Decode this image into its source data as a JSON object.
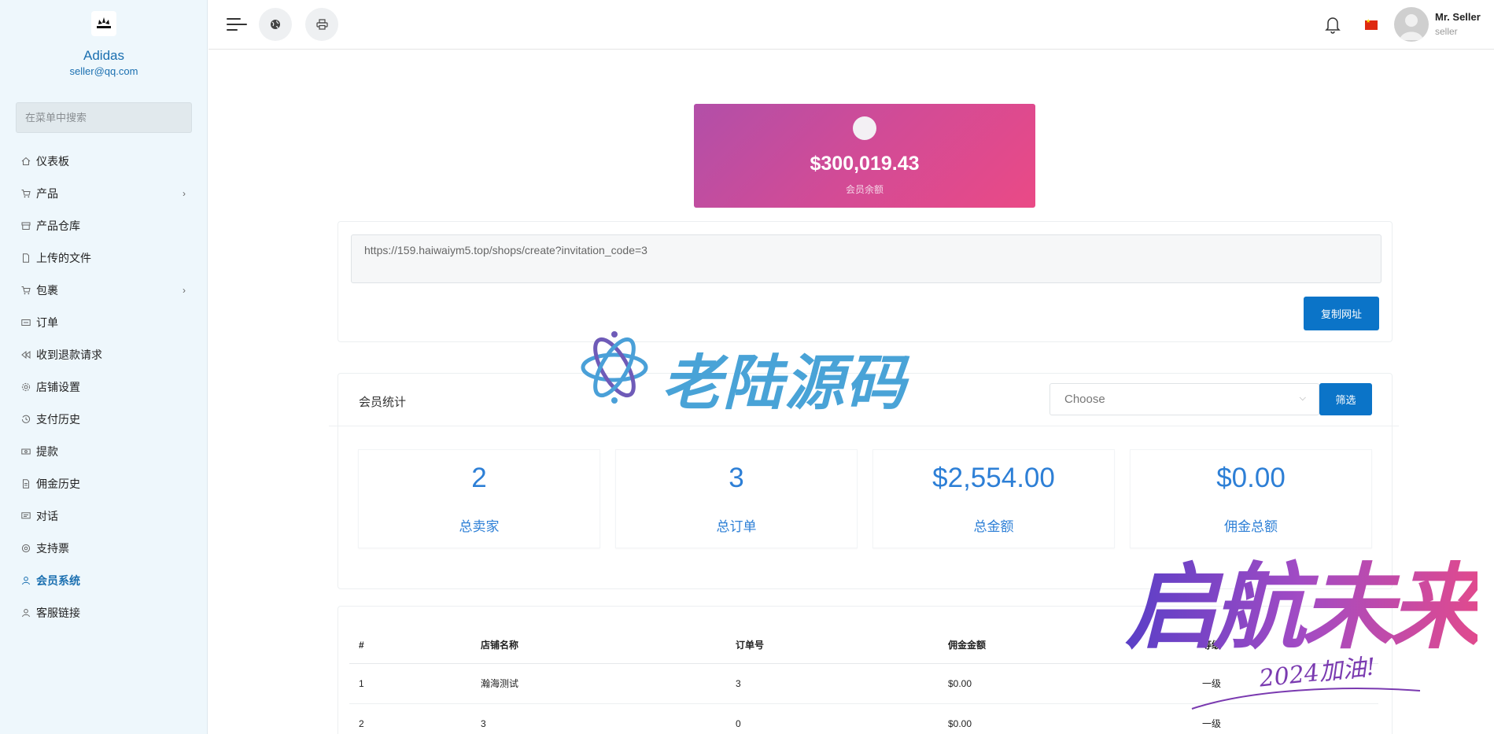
{
  "sidebar": {
    "brand_name": "Adidas",
    "brand_email": "seller@qq.com",
    "search_placeholder": "在菜单中搜索",
    "items": [
      {
        "label": "仪表板",
        "icon": "home-icon",
        "has_submenu": false,
        "active": false
      },
      {
        "label": "产品",
        "icon": "cart-icon",
        "has_submenu": true,
        "active": false
      },
      {
        "label": "产品仓库",
        "icon": "archive-icon",
        "has_submenu": false,
        "active": false
      },
      {
        "label": "上传的文件",
        "icon": "file-icon",
        "has_submenu": false,
        "active": false
      },
      {
        "label": "包裹",
        "icon": "cart-icon",
        "has_submenu": true,
        "active": false
      },
      {
        "label": "订单",
        "icon": "ticket-icon",
        "has_submenu": false,
        "active": false
      },
      {
        "label": "收到退款请求",
        "icon": "rewind-icon",
        "has_submenu": false,
        "active": false
      },
      {
        "label": "店铺设置",
        "icon": "gear-icon",
        "has_submenu": false,
        "active": false
      },
      {
        "label": "支付历史",
        "icon": "history-icon",
        "has_submenu": false,
        "active": false
      },
      {
        "label": "提款",
        "icon": "cash-icon",
        "has_submenu": false,
        "active": false
      },
      {
        "label": "佣金历史",
        "icon": "document-icon",
        "has_submenu": false,
        "active": false
      },
      {
        "label": "对话",
        "icon": "chat-icon",
        "has_submenu": false,
        "active": false
      },
      {
        "label": "支持票",
        "icon": "support-icon",
        "has_submenu": false,
        "active": false
      },
      {
        "label": "会员系统",
        "icon": "user-icon",
        "has_submenu": false,
        "active": true
      },
      {
        "label": "客服链接",
        "icon": "user-icon",
        "has_submenu": false,
        "active": false
      }
    ]
  },
  "topbar": {
    "user_name": "Mr. Seller",
    "user_role": "seller"
  },
  "balance": {
    "amount": "$300,019.43",
    "label": "会员余额"
  },
  "invite": {
    "url": "https://159.haiwaiym5.top/shops/create?invitation_code=3",
    "copy_label": "复制网址"
  },
  "stats": {
    "title": "会员统计",
    "select_placeholder": "Choose",
    "filter_label": "筛选",
    "tiles": [
      {
        "value": "2",
        "label": "总卖家"
      },
      {
        "value": "3",
        "label": "总订单"
      },
      {
        "value": "$2,554.00",
        "label": "总金额"
      },
      {
        "value": "$0.00",
        "label": "佣金总额"
      }
    ]
  },
  "table": {
    "headers": [
      "#",
      "店铺名称",
      "订单号",
      "佣金金额",
      "等级"
    ],
    "rows": [
      [
        "1",
        "瀚海测试",
        "3",
        "$0.00",
        "一级"
      ],
      [
        "2",
        "3",
        "0",
        "$0.00",
        "一级"
      ]
    ]
  },
  "watermarks": {
    "logo_text": "老陆源码",
    "slogan": "启航未来",
    "slogan_sub": "2024加油!"
  },
  "colors": {
    "accent": "#0b74c8",
    "stat_blue": "#2d7fd6",
    "sidebar_bg": "#eef7fc",
    "balance_gradient_start": "#b24fa8",
    "balance_gradient_end": "#ea4a86"
  }
}
